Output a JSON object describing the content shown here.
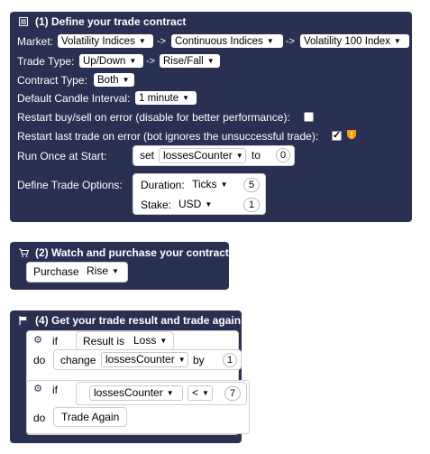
{
  "block1": {
    "title": "(1) Define your trade contract",
    "market_label": "Market:",
    "market": [
      "Volatility Indices",
      "Continuous Indices",
      "Volatility 100 Index"
    ],
    "arrow": "->",
    "trade_type_label": "Trade Type:",
    "trade_type": [
      "Up/Down",
      "Rise/Fall"
    ],
    "contract_type_label": "Contract Type:",
    "contract_type": "Both",
    "candle_label": "Default Candle Interval:",
    "candle_interval": "1 minute",
    "restart_error_label": "Restart buy/sell on error  (disable for better performance):",
    "restart_error_checked": false,
    "restart_last_label": "Restart last trade on error  (bot ignores the unsuccessful trade):",
    "restart_last_checked": true,
    "run_once_label": "Run Once at Start:",
    "set_label": "set",
    "set_var": "lossesCounter",
    "to_label": "to",
    "set_value": "0",
    "options_label": "Define Trade Options:",
    "duration_label": "Duration:",
    "duration_unit": "Ticks",
    "duration_value": "5",
    "stake_label": "Stake:",
    "stake_currency": "USD",
    "stake_value": "1"
  },
  "block2": {
    "title": "(2) Watch and purchase your contract",
    "purchase_label": "Purchase",
    "purchase_type": "Rise"
  },
  "block4": {
    "title": "(4) Get your trade result and trade again",
    "if_label": "if",
    "result_label": "Result is",
    "result_value": "Loss",
    "do_label": "do",
    "change_label": "change",
    "change_var": "lossesCounter",
    "by_label": "by",
    "change_value": "1",
    "if2_label": "if",
    "compare_var": "lossesCounter",
    "compare_op": "<",
    "compare_value": "7",
    "do2_label": "do",
    "trade_again_label": "Trade Again"
  }
}
